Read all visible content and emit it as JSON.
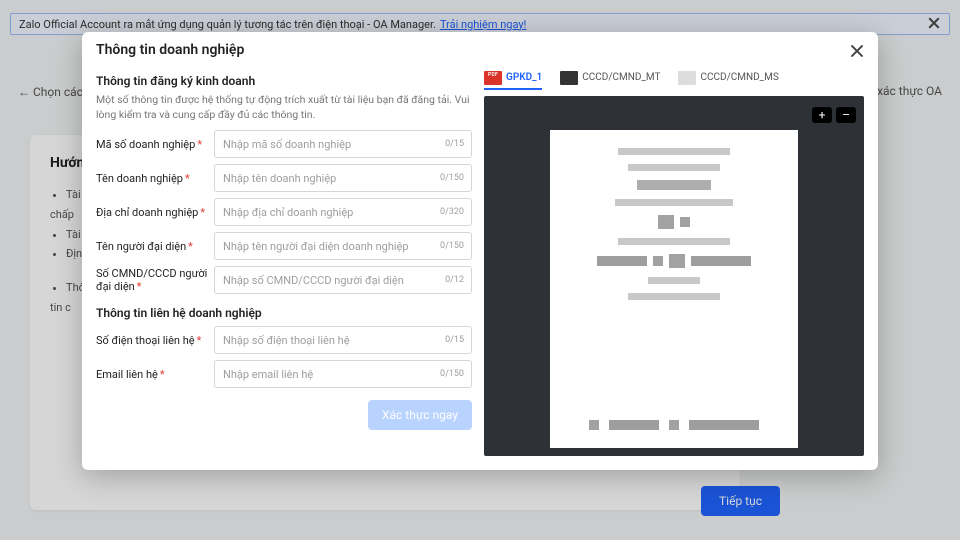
{
  "banner": {
    "text": "Zalo Official Account ra mắt ứng dụng quản lý tương tác trên điện thoại - OA Manager.",
    "link": "Trải nghiệm ngay!"
  },
  "background": {
    "crumb_left": "← Chọn các",
    "crumb_right": "ất xác thực OA",
    "heading": "Hướn",
    "bullets": [
      "Tài l",
      "chấp",
      "Tài l",
      "Định",
      "Thôr",
      "tin c"
    ],
    "continue": "Tiếp tục"
  },
  "modal": {
    "title": "Thông tin doanh nghiệp",
    "section1_title": "Thông tin đăng ký kinh doanh",
    "section1_desc": "Một số thông tin được hệ thống tự động trích xuất từ tài liệu bạn đã đăng tải. Vui lòng kiểm tra và cung cấp đầy đủ các thông tin.",
    "fields": {
      "biz_code": {
        "label": "Mã số doanh nghiệp",
        "ph": "Nhập mã số doanh nghiệp",
        "count": "0/15"
      },
      "biz_name": {
        "label": "Tên doanh nghiệp",
        "ph": "Nhập tên doanh nghiệp",
        "count": "0/150"
      },
      "biz_addr": {
        "label": "Địa chỉ doanh nghiệp",
        "ph": "Nhập địa chỉ doanh nghiệp",
        "count": "0/320"
      },
      "rep_name": {
        "label": "Tên người đại diện",
        "ph": "Nhập tên người đại diện doanh nghiệp",
        "count": "0/150"
      },
      "rep_id": {
        "label": "Số CMND/CCCD người đại diện",
        "ph": "Nhập số CMND/CCCD người đại diện",
        "count": "0/12"
      }
    },
    "section2_title": "Thông tin liên hệ doanh nghiệp",
    "fields2": {
      "phone": {
        "label": "Số điện thoại liên hệ",
        "ph": "Nhập số điện thoại liên hệ",
        "count": "0/15"
      },
      "email": {
        "label": "Email liên hệ",
        "ph": "Nhập email liên hệ",
        "count": "0/150"
      }
    },
    "verify": "Xác thực ngay"
  },
  "preview": {
    "tabs": [
      {
        "label": "GPKD_1",
        "active": true,
        "type": "pdf"
      },
      {
        "label": "CCCD/CMND_MT",
        "active": false,
        "type": "dark"
      },
      {
        "label": "CCCD/CMND_MS",
        "active": false,
        "type": "blank"
      }
    ],
    "zoom_in": "+",
    "zoom_out": "–"
  }
}
